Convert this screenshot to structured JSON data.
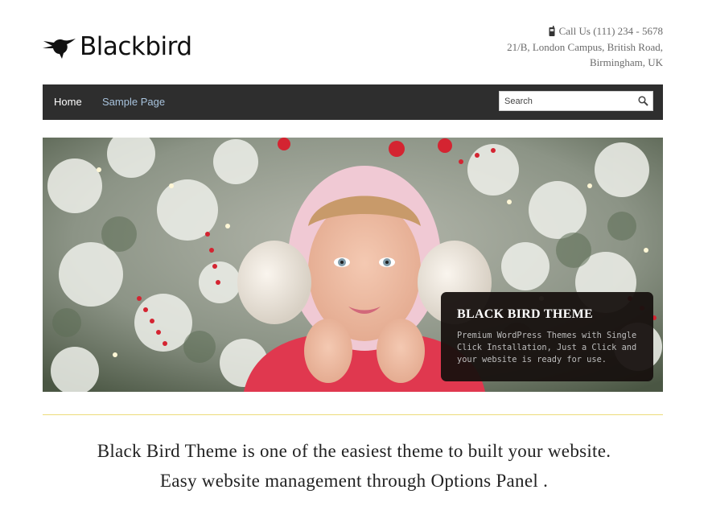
{
  "header": {
    "logo_text": "Blackbird",
    "logo_icon": "hummingbird-icon",
    "contact": {
      "phone_icon": "phone-icon",
      "phone": "Call Us (111) 234 - 5678",
      "address_line1": "21/B, London Campus, British Road,",
      "address_line2": "Birmingham, UK"
    }
  },
  "nav": {
    "items": [
      {
        "label": "Home"
      },
      {
        "label": "Sample Page"
      }
    ],
    "search": {
      "placeholder": "Search",
      "icon": "magnifier-icon"
    }
  },
  "hero": {
    "caption_title": "BLACK BIRD THEME",
    "caption_text": "Premium WordPress Themes with Single Click Installation, Just a Click and your website is ready for use."
  },
  "intro": {
    "line1": "Black Bird Theme is one of the easiest theme to built your website.",
    "line2": "Easy website management through Options Panel ."
  },
  "colors": {
    "nav_bg": "#2e2e2e",
    "nav_link": "#a8c3dd",
    "caption_bg": "#16100e",
    "divider": "#ecdc7a"
  }
}
